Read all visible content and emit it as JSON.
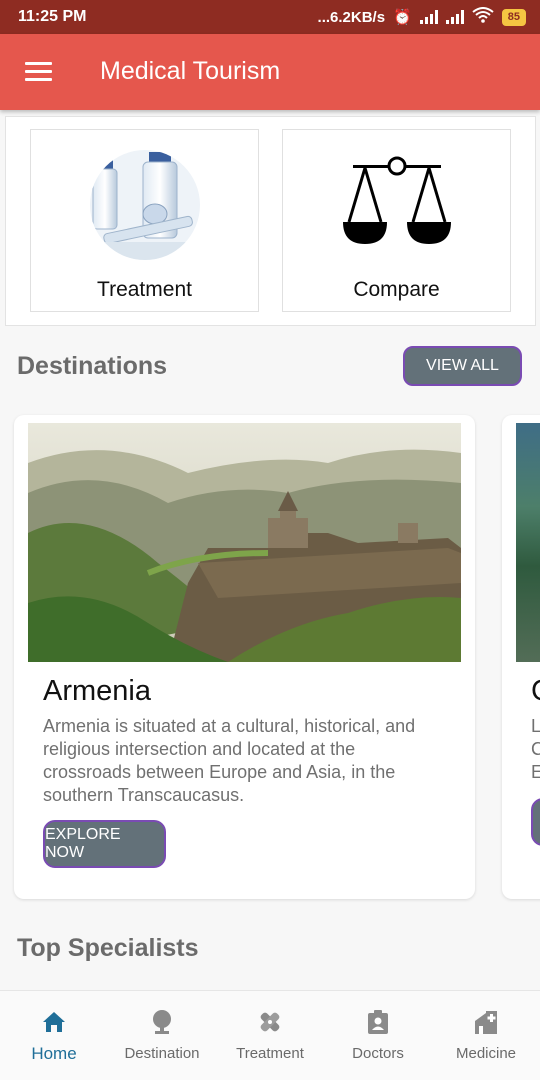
{
  "status_bar": {
    "time": "11:25 PM",
    "net_speed": "...6.2KB/s",
    "battery": "85"
  },
  "app_bar": {
    "title": "Medical Tourism",
    "menu_icon": "hamburger-menu-icon"
  },
  "quick_actions": [
    {
      "label": "Treatment",
      "icon": "medical-vials-image"
    },
    {
      "label": "Compare",
      "icon": "balance-scale-icon"
    }
  ],
  "destinations": {
    "title": "Destinations",
    "view_all_label": "VIEW ALL",
    "cards": [
      {
        "name": "Armenia",
        "description": "Armenia is situated at a cultural, historical, and religious intersection and located at the crossroads between Europe and Asia, in the southern Transcaucasus.",
        "button_label": "EXPLORE NOW"
      },
      {
        "name": "C",
        "description": "L\nC\nE",
        "button_label": ""
      }
    ]
  },
  "specialists": {
    "title": "Top Specialists"
  },
  "bottom_nav": [
    {
      "label": "Home",
      "icon": "home-icon",
      "active": true
    },
    {
      "label": "Destination",
      "icon": "map-pin-icon",
      "active": false
    },
    {
      "label": "Treatment",
      "icon": "bandage-icon",
      "active": false
    },
    {
      "label": "Doctors",
      "icon": "doctor-badge-icon",
      "active": false
    },
    {
      "label": "Medicine",
      "icon": "hospital-icon",
      "active": false
    }
  ],
  "colors": {
    "app_bar": "#e5574d",
    "status_bar": "#8e2c22",
    "button": "#637179",
    "button_border": "#7a4bb3",
    "active_nav": "#1f6e98"
  }
}
